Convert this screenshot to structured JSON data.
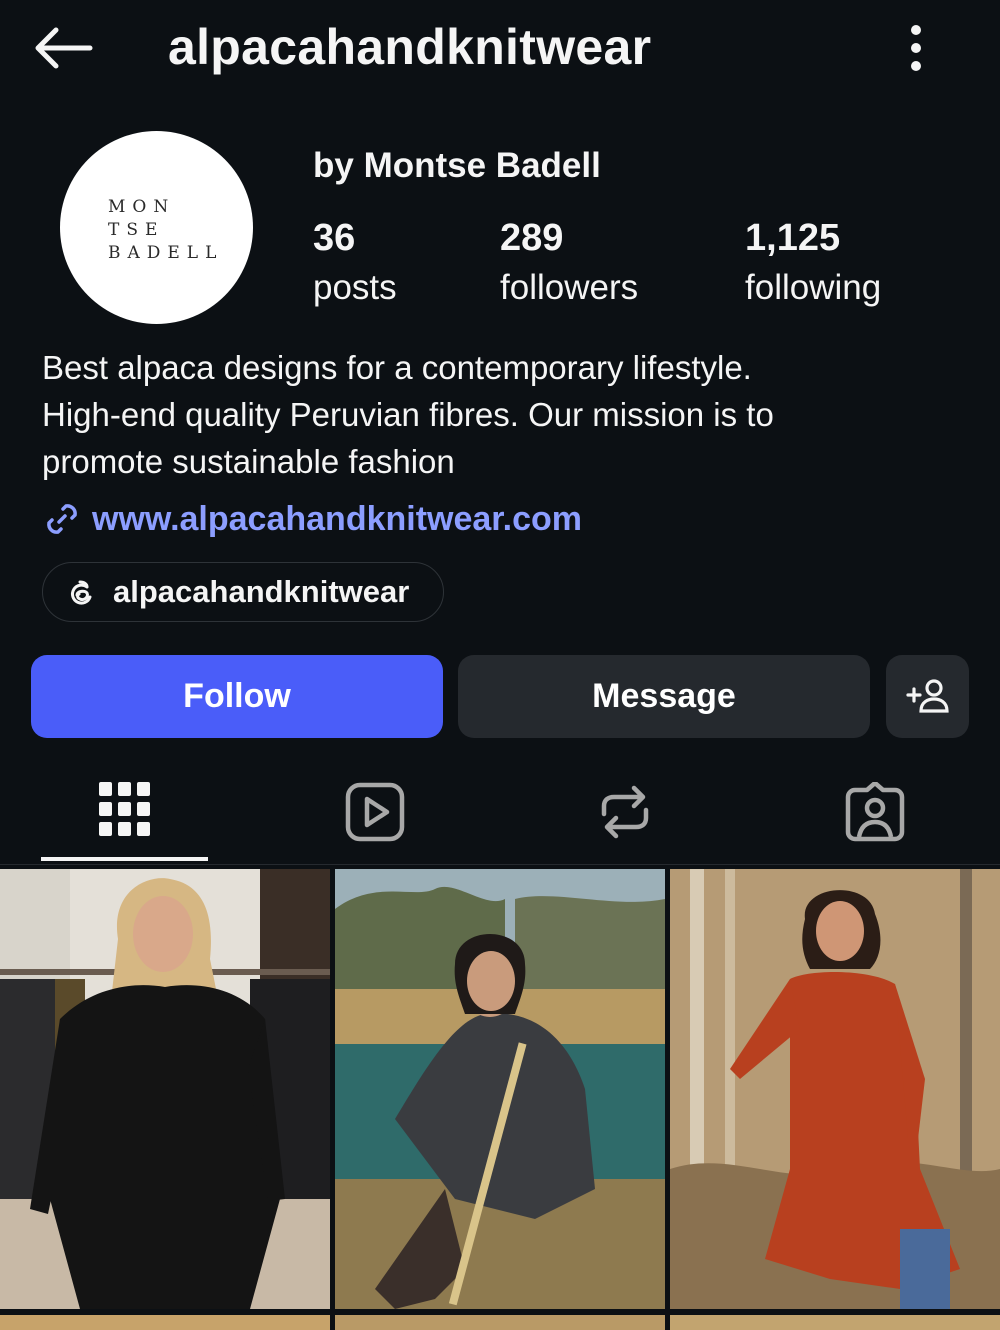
{
  "header": {
    "username": "alpacahandknitwear",
    "back_icon": "arrow-left-icon",
    "more_icon": "more-vertical-icon"
  },
  "profile": {
    "avatar_logo_lines": [
      "MON",
      "TSE",
      "BADELL"
    ],
    "display_name": "by Montse Badell",
    "stats": {
      "posts": {
        "value": "36",
        "label": "posts"
      },
      "followers": {
        "value": "289",
        "label": "followers"
      },
      "following": {
        "value": "1,125",
        "label": "following"
      }
    },
    "bio_lines": [
      "Best alpaca designs for a contemporary lifestyle.",
      "High-end quality Peruvian fibres. Our mission is to",
      "promote sustainable fashion"
    ],
    "link": "www.alpacahandknitwear.com",
    "threads_handle": "alpacahandknitwear"
  },
  "actions": {
    "follow_label": "Follow",
    "message_label": "Message",
    "add_user_icon": "add-user-icon"
  },
  "tabs": [
    {
      "icon": "grid-icon",
      "active": true
    },
    {
      "icon": "reels-icon",
      "active": false
    },
    {
      "icon": "reposts-icon",
      "active": false
    },
    {
      "icon": "tagged-icon",
      "active": false
    }
  ],
  "colors": {
    "background": "#0c1014",
    "accent": "#4a5df9",
    "link": "#8c9eff",
    "secondary_button": "#25292e"
  }
}
